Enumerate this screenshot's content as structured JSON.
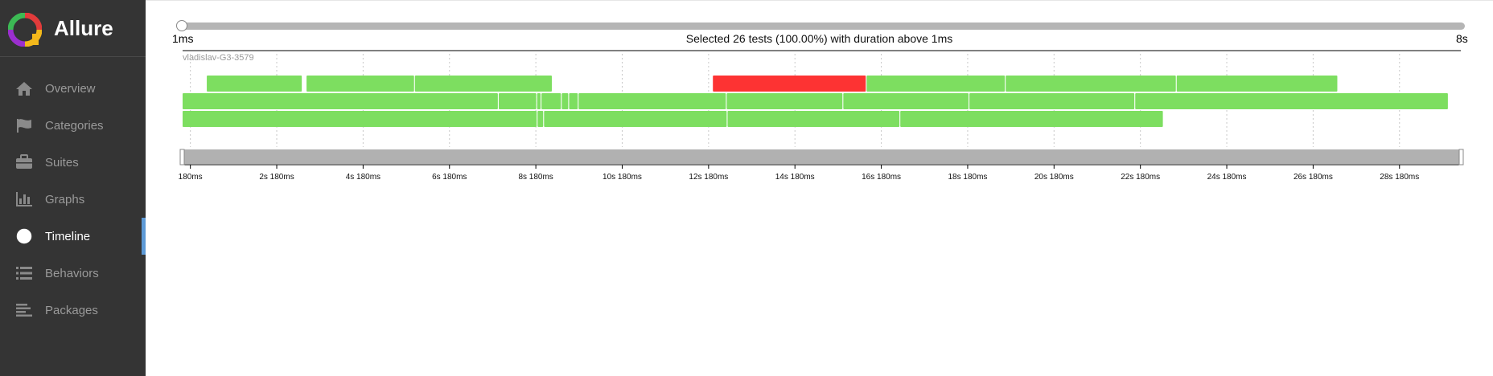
{
  "app": {
    "title": "Allure"
  },
  "sidebar": {
    "items": [
      {
        "label": "Overview",
        "icon": "home-icon",
        "active": false
      },
      {
        "label": "Categories",
        "icon": "flag-icon",
        "active": false
      },
      {
        "label": "Suites",
        "icon": "briefcase-icon",
        "active": false
      },
      {
        "label": "Graphs",
        "icon": "bar-chart-icon",
        "active": false
      },
      {
        "label": "Timeline",
        "icon": "clock-icon",
        "active": true
      },
      {
        "label": "Behaviors",
        "icon": "list-icon",
        "active": false
      },
      {
        "label": "Packages",
        "icon": "align-left-icon",
        "active": false
      }
    ]
  },
  "duration_filter": {
    "min_label": "1ms",
    "max_label": "8s",
    "summary": "Selected 26 tests (100.00%) with duration above 1ms"
  },
  "timeline": {
    "host": "vladislav-G3-3579",
    "ticks": [
      "180ms",
      "2s 180ms",
      "4s 180ms",
      "6s 180ms",
      "8s 180ms",
      "10s 180ms",
      "12s 180ms",
      "14s 180ms",
      "16s 180ms",
      "18s 180ms",
      "20s 180ms",
      "22s 180ms",
      "24s 180ms",
      "26s 180ms",
      "28s 180ms"
    ],
    "tick_values_s": [
      0.18,
      2.18,
      4.18,
      6.18,
      8.18,
      10.18,
      12.18,
      14.18,
      16.18,
      18.18,
      20.18,
      22.18,
      24.18,
      26.18,
      28.18
    ],
    "range_s": [
      0.0,
      29.6
    ],
    "colors": {
      "passed": "#7dde60",
      "failed": "#fd3333"
    },
    "rows": [
      [
        {
          "start": 0.56,
          "end": 2.76,
          "status": "passed"
        },
        {
          "start": 2.87,
          "end": 5.36,
          "status": "passed"
        },
        {
          "start": 5.38,
          "end": 8.55,
          "status": "passed"
        },
        {
          "start": 12.28,
          "end": 15.82,
          "status": "failed"
        },
        {
          "start": 15.84,
          "end": 19.04,
          "status": "passed"
        },
        {
          "start": 19.06,
          "end": 23.0,
          "status": "passed"
        },
        {
          "start": 23.02,
          "end": 26.74,
          "status": "passed"
        }
      ],
      [
        {
          "start": 0.0,
          "end": 7.3,
          "status": "passed"
        },
        {
          "start": 7.32,
          "end": 8.19,
          "status": "passed"
        },
        {
          "start": 8.21,
          "end": 8.29,
          "status": "passed"
        },
        {
          "start": 8.31,
          "end": 8.76,
          "status": "passed"
        },
        {
          "start": 8.78,
          "end": 8.93,
          "status": "passed"
        },
        {
          "start": 8.95,
          "end": 9.15,
          "status": "passed"
        },
        {
          "start": 9.17,
          "end": 12.58,
          "status": "passed"
        },
        {
          "start": 12.6,
          "end": 15.28,
          "status": "passed"
        },
        {
          "start": 15.3,
          "end": 18.2,
          "status": "passed"
        },
        {
          "start": 18.22,
          "end": 22.04,
          "status": "passed"
        },
        {
          "start": 22.06,
          "end": 29.3,
          "status": "passed"
        }
      ],
      [
        {
          "start": 0.0,
          "end": 8.2,
          "status": "passed"
        },
        {
          "start": 8.22,
          "end": 8.35,
          "status": "passed"
        },
        {
          "start": 8.37,
          "end": 12.6,
          "status": "passed"
        },
        {
          "start": 12.62,
          "end": 16.6,
          "status": "passed"
        },
        {
          "start": 16.62,
          "end": 22.7,
          "status": "passed"
        }
      ]
    ]
  }
}
